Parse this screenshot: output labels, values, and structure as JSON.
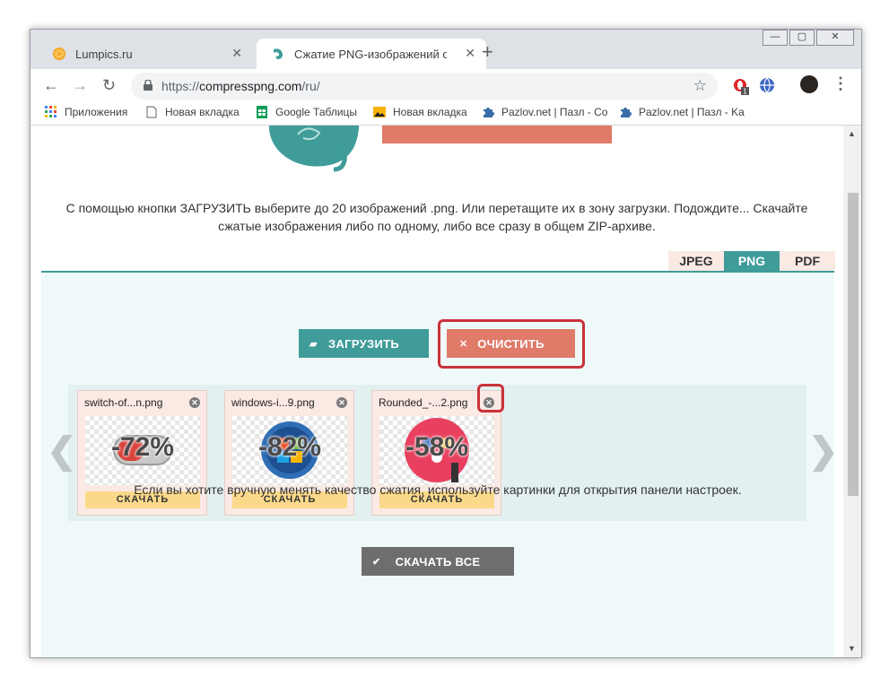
{
  "browser": {
    "tabs": [
      {
        "title": "Lumpics.ru",
        "favicon": "orange-slice-icon"
      },
      {
        "title": "Сжатие PNG-изображений онлайн",
        "favicon": "mascot-icon"
      }
    ],
    "url_prefix": "https://",
    "url_domain": "compresspng.com",
    "url_path": "/ru/",
    "extension_badge": "1",
    "bookmarks": [
      {
        "label": "Приложения",
        "icon": "apps-grid-icon"
      },
      {
        "label": "Новая вкладка",
        "icon": "page-icon"
      },
      {
        "label": "Google Таблицы",
        "icon": "sheets-icon"
      },
      {
        "label": "Новая вкладка",
        "icon": "image-icon"
      },
      {
        "label": "Pazlov.net | Пазл - Co",
        "icon": "puzzle-icon"
      },
      {
        "label": "Pazlov.net | Пазл - Ka",
        "icon": "puzzle-icon"
      }
    ]
  },
  "page": {
    "description": "С помощью кнопки ЗАГРУЗИТЬ выберите до 20 изображений .png. Или перетащите их в зону загрузки. Подождите... Скачайте сжатые изображения либо по одному, либо все сразу в общем ZIP-архиве.",
    "format_tabs": [
      {
        "label": "JPEG"
      },
      {
        "label": "PNG"
      },
      {
        "label": "PDF"
      }
    ],
    "active_tab": "PNG",
    "upload_label": "ЗАГРУЗИТЬ",
    "clear_label": "ОЧИСТИТЬ",
    "files": [
      {
        "name": "switch-of...n.png",
        "percent": "-72%",
        "download": "СКАЧАТЬ"
      },
      {
        "name": "windows-i...9.png",
        "percent": "-82%",
        "download": "СКАЧАТЬ"
      },
      {
        "name": "Rounded_-...2.png",
        "percent": "-58%",
        "download": "СКАЧАТЬ"
      }
    ],
    "download_all_label": "СКАЧАТЬ ВСЕ",
    "note": "Если вы хотите вручную менять качество сжатия, используйте картинки для открытия панели настроек."
  },
  "colors": {
    "teal": "#3f9c99",
    "salmon": "#e07a69",
    "highlight": "#c9323a",
    "download_yellow": "#fbd98a"
  }
}
